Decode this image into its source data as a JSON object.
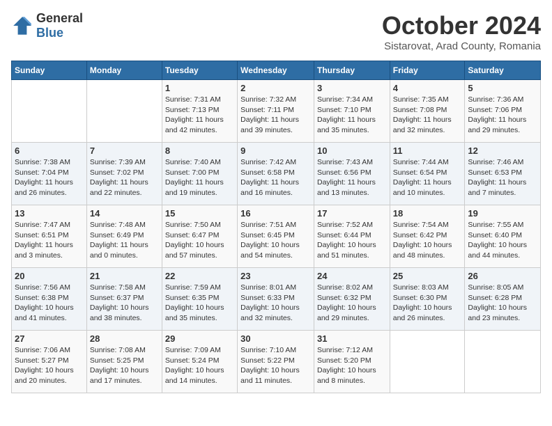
{
  "logo": {
    "general": "General",
    "blue": "Blue"
  },
  "header": {
    "title": "October 2024",
    "location": "Sistarovat, Arad County, Romania"
  },
  "weekdays": [
    "Sunday",
    "Monday",
    "Tuesday",
    "Wednesday",
    "Thursday",
    "Friday",
    "Saturday"
  ],
  "weeks": [
    [
      {
        "day": "",
        "info": ""
      },
      {
        "day": "",
        "info": ""
      },
      {
        "day": "1",
        "info": "Sunrise: 7:31 AM\nSunset: 7:13 PM\nDaylight: 11 hours and 42 minutes."
      },
      {
        "day": "2",
        "info": "Sunrise: 7:32 AM\nSunset: 7:11 PM\nDaylight: 11 hours and 39 minutes."
      },
      {
        "day": "3",
        "info": "Sunrise: 7:34 AM\nSunset: 7:10 PM\nDaylight: 11 hours and 35 minutes."
      },
      {
        "day": "4",
        "info": "Sunrise: 7:35 AM\nSunset: 7:08 PM\nDaylight: 11 hours and 32 minutes."
      },
      {
        "day": "5",
        "info": "Sunrise: 7:36 AM\nSunset: 7:06 PM\nDaylight: 11 hours and 29 minutes."
      }
    ],
    [
      {
        "day": "6",
        "info": "Sunrise: 7:38 AM\nSunset: 7:04 PM\nDaylight: 11 hours and 26 minutes."
      },
      {
        "day": "7",
        "info": "Sunrise: 7:39 AM\nSunset: 7:02 PM\nDaylight: 11 hours and 22 minutes."
      },
      {
        "day": "8",
        "info": "Sunrise: 7:40 AM\nSunset: 7:00 PM\nDaylight: 11 hours and 19 minutes."
      },
      {
        "day": "9",
        "info": "Sunrise: 7:42 AM\nSunset: 6:58 PM\nDaylight: 11 hours and 16 minutes."
      },
      {
        "day": "10",
        "info": "Sunrise: 7:43 AM\nSunset: 6:56 PM\nDaylight: 11 hours and 13 minutes."
      },
      {
        "day": "11",
        "info": "Sunrise: 7:44 AM\nSunset: 6:54 PM\nDaylight: 11 hours and 10 minutes."
      },
      {
        "day": "12",
        "info": "Sunrise: 7:46 AM\nSunset: 6:53 PM\nDaylight: 11 hours and 7 minutes."
      }
    ],
    [
      {
        "day": "13",
        "info": "Sunrise: 7:47 AM\nSunset: 6:51 PM\nDaylight: 11 hours and 3 minutes."
      },
      {
        "day": "14",
        "info": "Sunrise: 7:48 AM\nSunset: 6:49 PM\nDaylight: 11 hours and 0 minutes."
      },
      {
        "day": "15",
        "info": "Sunrise: 7:50 AM\nSunset: 6:47 PM\nDaylight: 10 hours and 57 minutes."
      },
      {
        "day": "16",
        "info": "Sunrise: 7:51 AM\nSunset: 6:45 PM\nDaylight: 10 hours and 54 minutes."
      },
      {
        "day": "17",
        "info": "Sunrise: 7:52 AM\nSunset: 6:44 PM\nDaylight: 10 hours and 51 minutes."
      },
      {
        "day": "18",
        "info": "Sunrise: 7:54 AM\nSunset: 6:42 PM\nDaylight: 10 hours and 48 minutes."
      },
      {
        "day": "19",
        "info": "Sunrise: 7:55 AM\nSunset: 6:40 PM\nDaylight: 10 hours and 44 minutes."
      }
    ],
    [
      {
        "day": "20",
        "info": "Sunrise: 7:56 AM\nSunset: 6:38 PM\nDaylight: 10 hours and 41 minutes."
      },
      {
        "day": "21",
        "info": "Sunrise: 7:58 AM\nSunset: 6:37 PM\nDaylight: 10 hours and 38 minutes."
      },
      {
        "day": "22",
        "info": "Sunrise: 7:59 AM\nSunset: 6:35 PM\nDaylight: 10 hours and 35 minutes."
      },
      {
        "day": "23",
        "info": "Sunrise: 8:01 AM\nSunset: 6:33 PM\nDaylight: 10 hours and 32 minutes."
      },
      {
        "day": "24",
        "info": "Sunrise: 8:02 AM\nSunset: 6:32 PM\nDaylight: 10 hours and 29 minutes."
      },
      {
        "day": "25",
        "info": "Sunrise: 8:03 AM\nSunset: 6:30 PM\nDaylight: 10 hours and 26 minutes."
      },
      {
        "day": "26",
        "info": "Sunrise: 8:05 AM\nSunset: 6:28 PM\nDaylight: 10 hours and 23 minutes."
      }
    ],
    [
      {
        "day": "27",
        "info": "Sunrise: 7:06 AM\nSunset: 5:27 PM\nDaylight: 10 hours and 20 minutes."
      },
      {
        "day": "28",
        "info": "Sunrise: 7:08 AM\nSunset: 5:25 PM\nDaylight: 10 hours and 17 minutes."
      },
      {
        "day": "29",
        "info": "Sunrise: 7:09 AM\nSunset: 5:24 PM\nDaylight: 10 hours and 14 minutes."
      },
      {
        "day": "30",
        "info": "Sunrise: 7:10 AM\nSunset: 5:22 PM\nDaylight: 10 hours and 11 minutes."
      },
      {
        "day": "31",
        "info": "Sunrise: 7:12 AM\nSunset: 5:20 PM\nDaylight: 10 hours and 8 minutes."
      },
      {
        "day": "",
        "info": ""
      },
      {
        "day": "",
        "info": ""
      }
    ]
  ]
}
